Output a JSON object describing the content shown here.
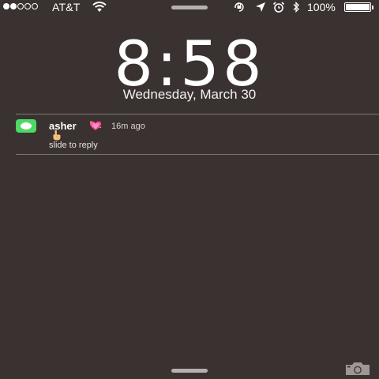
{
  "status_bar": {
    "signal": {
      "filled": 2,
      "total": 5
    },
    "carrier": "AT&T",
    "wifi_icon": "wifi-icon",
    "rotation_lock_icon": "rotation-lock-icon",
    "location_icon": "location-arrow-icon",
    "alarm_icon": "alarm-clock-icon",
    "bluetooth_icon": "bluetooth-icon",
    "battery_percent": "100%",
    "battery_level": 1.0
  },
  "lock_screen": {
    "time": "8:58",
    "date": "Wednesday, March 30"
  },
  "notification": {
    "app_icon": "messages-icon",
    "sender": "asher",
    "sender_emoji": "sparkling-heart",
    "time_ago": "16m ago",
    "message_emoji": "pointing-hand",
    "action_hint": "slide to reply"
  },
  "bottom": {
    "camera_icon": "camera-icon"
  },
  "colors": {
    "background": "#3a3231",
    "messages_green": "#4cd964",
    "heart_pink": "#ff4fa3"
  }
}
